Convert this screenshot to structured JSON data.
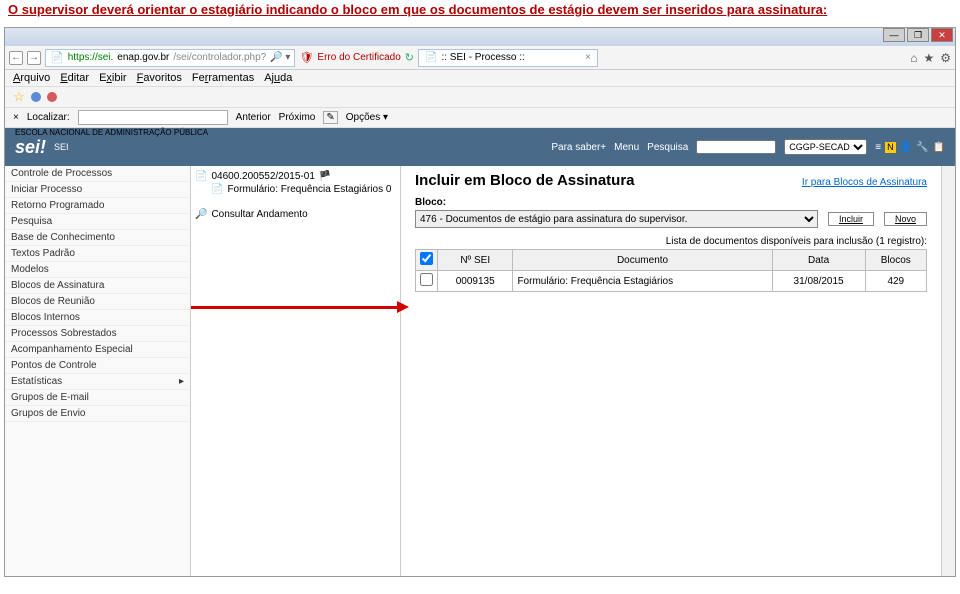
{
  "instruction": "O supervisor deverá orientar o estagiário indicando o bloco em que os documentos de estágio devem ser inseridos para assinatura:",
  "browser": {
    "url_prefix": "https://sei.",
    "url_host": "enap.gov.br",
    "url_path": "/sei/controlador.php?",
    "cert_error": "Erro do Certificado",
    "tab_title": ":: SEI - Processo ::",
    "menu": [
      "Arquivo",
      "Editar",
      "Exibir",
      "Favoritos",
      "Ferramentas",
      "Ajuda"
    ],
    "find_label": "Localizar:",
    "find_prev": "Anterior",
    "find_next": "Próximo",
    "find_options": "Opções"
  },
  "header": {
    "org": "ESCOLA NACIONAL DE ADMINISTRAÇÃO PÚBLICA",
    "logo": "sei!",
    "sub": "SEI",
    "links": [
      "Para saber+",
      "Menu",
      "Pesquisa"
    ],
    "unit": "CGGP-SECAD"
  },
  "sidebar": {
    "items": [
      "Controle de Processos",
      "Iniciar Processo",
      "Retorno Programado",
      "Pesquisa",
      "Base de Conhecimento",
      "Textos Padrão",
      "Modelos",
      "Blocos de Assinatura",
      "Blocos de Reunião",
      "Blocos Internos",
      "Processos Sobrestados",
      "Acompanhamento Especial",
      "Pontos de Controle",
      "Estatísticas",
      "Grupos de E-mail",
      "Grupos de Envio"
    ]
  },
  "tree": {
    "process": "04600.200552/2015-01",
    "doc": "Formulário: Frequência Estagiários 0",
    "action": "Consultar Andamento"
  },
  "main": {
    "title": "Incluir em Bloco de Assinatura",
    "goto_link": "Ir para Blocos de Assinatura",
    "bloco_label": "Bloco:",
    "bloco_selected": "476 - Documentos de estágio para assinatura do supervisor.",
    "btn_incluir": "Incluir",
    "btn_novo": "Novo",
    "list_caption": "Lista de documentos disponíveis para inclusão (1 registro):",
    "table": {
      "headers": [
        "",
        "Nº SEI",
        "Documento",
        "Data",
        "Blocos"
      ],
      "rows": [
        {
          "num": "0009135",
          "doc": "Formulário: Frequência Estagiários",
          "data": "31/08/2015",
          "blocos": "429"
        }
      ]
    }
  }
}
